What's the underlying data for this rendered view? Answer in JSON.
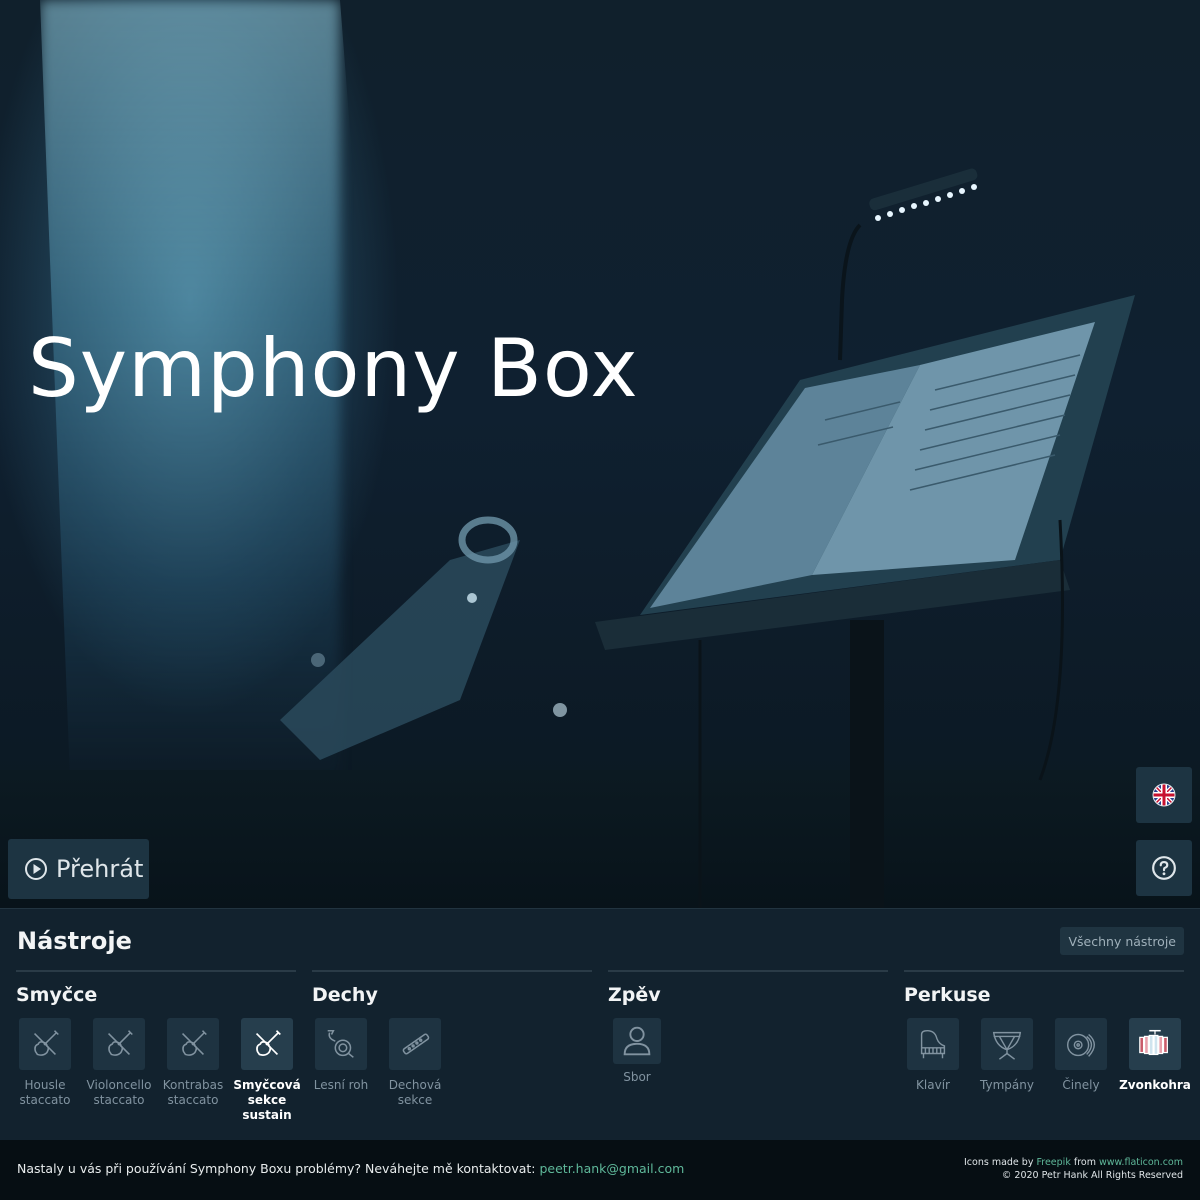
{
  "hero": {
    "title": "Symphony Box",
    "play_label": "Přehrát",
    "language_icon": "uk-flag-icon",
    "help_icon": "question-circle-icon"
  },
  "panel": {
    "title": "Nástroje",
    "all_label": "Všechny nástroje",
    "groups": [
      {
        "name": "Smyčce",
        "items": [
          {
            "label": "Housle staccato",
            "icon": "violin-icon",
            "active": false
          },
          {
            "label": "Violoncello staccato",
            "icon": "violin-icon",
            "active": false
          },
          {
            "label": "Kontrabas staccato",
            "icon": "violin-icon",
            "active": false
          },
          {
            "label": "Smyčcová sekce sustain",
            "icon": "violin-icon",
            "active": true
          }
        ]
      },
      {
        "name": "Dechy",
        "items": [
          {
            "label": "Lesní roh",
            "icon": "french-horn-icon",
            "active": false
          },
          {
            "label": "Dechová sekce",
            "icon": "flute-icon",
            "active": false
          }
        ]
      },
      {
        "name": "Zpěv",
        "items": [
          {
            "label": "Sbor",
            "icon": "person-icon",
            "active": false
          }
        ]
      },
      {
        "name": "Perkuse",
        "items": [
          {
            "label": "Klavír",
            "icon": "piano-icon",
            "active": false
          },
          {
            "label": "Tympány",
            "icon": "timpani-icon",
            "active": false
          },
          {
            "label": "Činely",
            "icon": "cymbals-icon",
            "active": false
          },
          {
            "label": "Zvonkohra",
            "icon": "glockenspiel-icon",
            "active": true
          }
        ]
      }
    ]
  },
  "footer": {
    "message": "Nastaly u vás při používání Symphony Boxu problémy? Neváhejte mě kontaktovat:",
    "email": "peetr.hank@gmail.com",
    "credits_prefix": "Icons made by",
    "credits_author": "Freepik",
    "credits_from": "from",
    "credits_site": "www.flaticon.com",
    "copyright": "© 2020 Petr Hank All Rights Reserved"
  },
  "colors": {
    "accent_link": "#5fb89a",
    "panel_bg": "#12222e",
    "tile_bg": "#1e3341"
  }
}
